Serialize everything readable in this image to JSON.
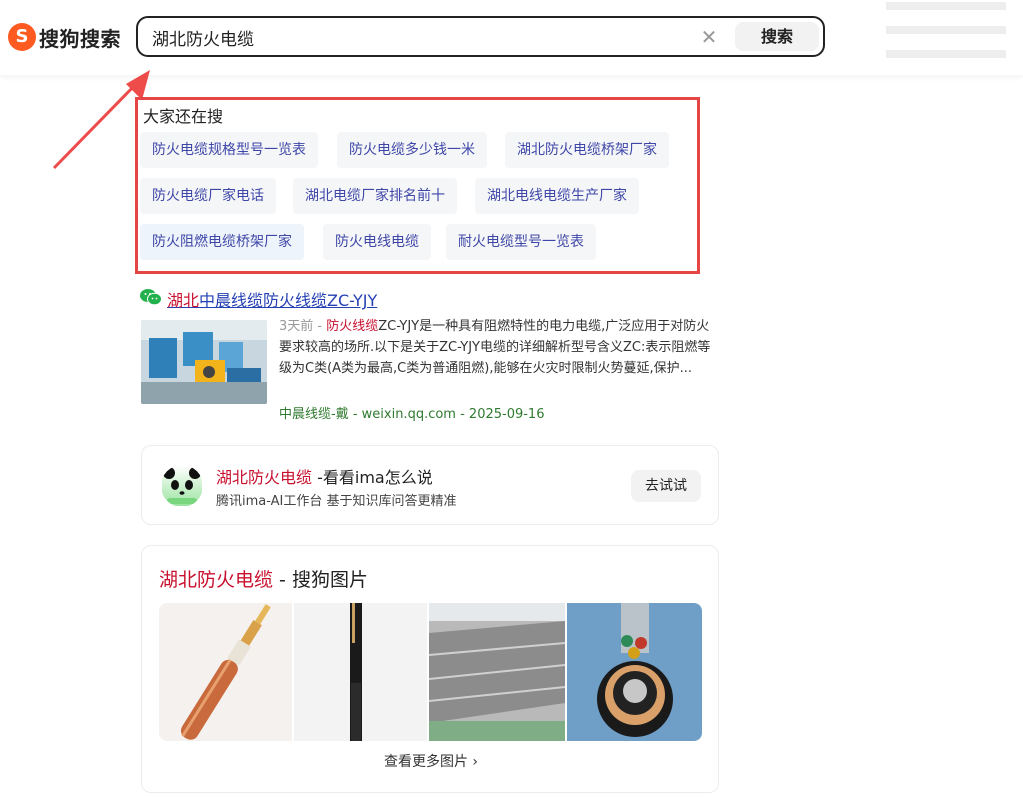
{
  "header": {
    "logo_text": "搜狗搜索",
    "search_value": "湖北防火电缆",
    "search_button": "搜索",
    "clear_icon": "close-icon"
  },
  "related": {
    "title": "大家还在搜",
    "chips": [
      "防火电缆规格型号一览表",
      "防火电缆多少钱一米",
      "湖北防火电缆桥架厂家",
      "防火电缆厂家电话",
      "湖北电缆厂家排名前十",
      "湖北电线电缆生产厂家",
      "防火阻燃电缆桥架厂家",
      "防火电线电缆",
      "耐火电缆型号一览表"
    ]
  },
  "result1": {
    "title_prefix": "湖北",
    "title_rest": "中晨线缆防火线缆ZC-YJY",
    "time": "3天前 - ",
    "desc_highlight": "防火线缆",
    "desc_rest": "ZC-YJY是一种具有阻燃特性的电力电缆,广泛应用于对防火要求较高的场所.以下是关于ZC-YJY电缆的详细解析型号含义ZC:表示阻燃等级为C类(A类为最高,C类为普通阻燃),能够在火灾时限制火势蔓延,保护...",
    "source": "中晨线缆-戴 - weixin.qq.com  - 2025-09-16"
  },
  "ima": {
    "title_highlight": "湖北防火电缆",
    "title_rest": " -看看ima怎么说",
    "subtitle": "腾讯ima-AI工作台 基于知识库问答更精准",
    "button": "去试试"
  },
  "images": {
    "title_highlight": "湖北防火电缆",
    "title_rest": " - 搜狗图片",
    "more": "查看更多图片 ›"
  }
}
